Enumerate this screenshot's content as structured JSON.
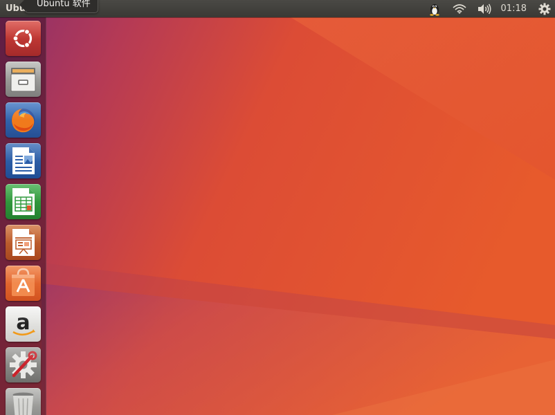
{
  "top_panel": {
    "app_title": "Ubuntu",
    "clock": "01:18",
    "indicators": [
      "tux-icon",
      "wifi-icon",
      "volume-icon",
      "power-gear-icon"
    ]
  },
  "tooltip": {
    "text": "Ubuntu 软件"
  },
  "launcher": {
    "items": [
      {
        "name": "ubuntu-dash",
        "icon": "ubuntu-logo-icon",
        "color": "#c9342f"
      },
      {
        "name": "files",
        "icon": "file-cabinet-icon",
        "color": "#9a9a98"
      },
      {
        "name": "firefox",
        "icon": "firefox-icon",
        "color": "#3b6fb6"
      },
      {
        "name": "libreoffice-writer",
        "icon": "writer-document-icon",
        "color": "#2a5da8"
      },
      {
        "name": "libreoffice-calc",
        "icon": "calc-spreadsheet-icon",
        "color": "#2e9a3c"
      },
      {
        "name": "libreoffice-impress",
        "icon": "impress-presentation-icon",
        "color": "#c05e2c"
      },
      {
        "name": "ubuntu-software",
        "icon": "software-bag-icon",
        "color": "#e6692f"
      },
      {
        "name": "amazon",
        "icon": "amazon-icon",
        "color": "#e8e8e6"
      },
      {
        "name": "system-settings",
        "icon": "settings-gear-wrench-icon",
        "color": "#8a8a88"
      },
      {
        "name": "trash",
        "icon": "trash-icon",
        "color": "#9c9c9a"
      }
    ]
  },
  "colors": {
    "wallpaper_orange": "#e25a2f",
    "wallpaper_purple": "#8a2f6e",
    "panel": "#3c3b37"
  }
}
